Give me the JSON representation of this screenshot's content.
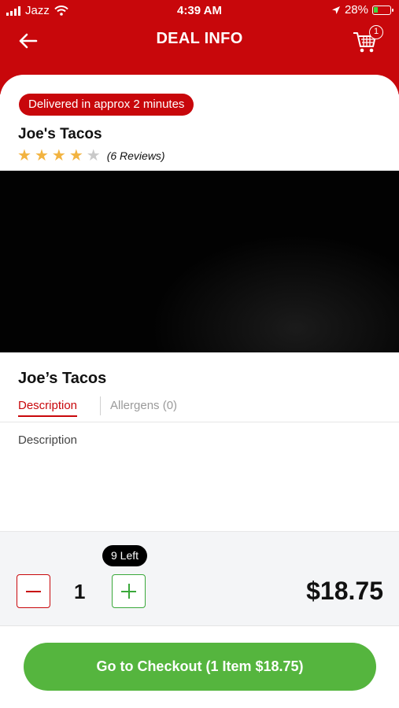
{
  "status_bar": {
    "carrier": "Jazz",
    "time": "4:39 AM",
    "battery_percent": "28%",
    "battery_level": 0.28,
    "icons": [
      "signal-icon",
      "wifi-icon",
      "location-arrow-icon",
      "battery-icon"
    ]
  },
  "header": {
    "title": "DEAL INFO",
    "cart_count": "1",
    "icons": [
      "back-arrow-icon",
      "cart-icon"
    ]
  },
  "store": {
    "delivery_pill": "Delivered in approx 2 minutes",
    "name": "Joe's Tacos",
    "rating": 4,
    "rating_max": 5,
    "reviews_label": "(6 Reviews)"
  },
  "item": {
    "name": "Joe’s Tacos",
    "tabs": [
      {
        "label": "Description",
        "active": true
      },
      {
        "label": "Allergens (0)",
        "active": false
      }
    ],
    "description": "Description"
  },
  "quantity": {
    "left_badge": "9 Left",
    "value": "1",
    "price": "$18.75"
  },
  "checkout": {
    "label": "Go to Checkout (1 Item $18.75)"
  },
  "colors": {
    "brand_red": "#c8070b",
    "checkout_green": "#55b53e",
    "plus_green": "#3aa83a",
    "star_gold": "#f2b340",
    "star_grey": "#c9c9c9"
  }
}
